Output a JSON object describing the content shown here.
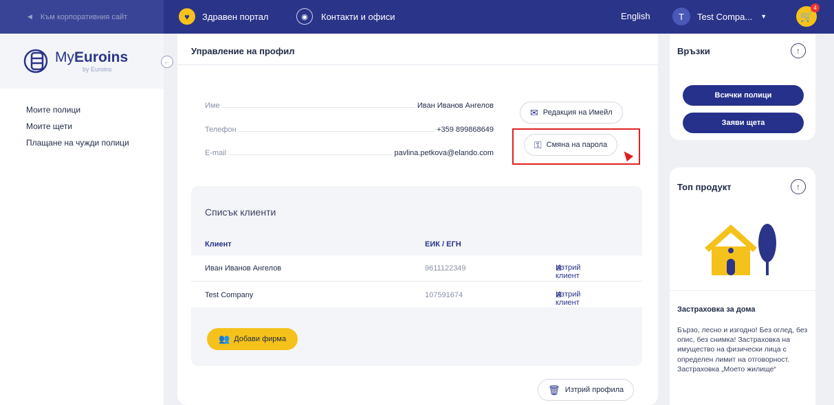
{
  "topbar": {
    "back_link": "Към корпоративния сайт",
    "health_portal": "Здравен портал",
    "contacts": "Контакти и офиси",
    "language": "English",
    "user_initial": "T",
    "user_name": "Test Compa...",
    "cart_count": "4"
  },
  "sidebar": {
    "logo_prefix": "My",
    "logo_bold": "Euroins",
    "logo_sub": "by Euroins",
    "items": [
      {
        "label": "Моите полици"
      },
      {
        "label": "Моите щети"
      },
      {
        "label": "Плащане на чужди полици"
      }
    ]
  },
  "profile": {
    "title": "Управление на профил",
    "name_label": "Име",
    "name_value": "Иван Иванов Ангелов",
    "phone_label": "Телефон",
    "phone_value": "+359 899868649",
    "email_label": "E-mail",
    "email_value": "pavlina.petkova@elando.com",
    "edit_email_btn": "Редакция на Имейл",
    "change_password_btn": "Смяна на парола",
    "delete_profile_btn": "Изтрий профила"
  },
  "clients": {
    "title": "Списък клиенти",
    "col_client": "Клиент",
    "col_eik": "ЕИК / ЕГН",
    "rows": [
      {
        "name": "Иван Иванов Ангелов",
        "eik": "9611122349",
        "action": "Изтрий клиент"
      },
      {
        "name": "Test Company",
        "eik": "107591674",
        "action": "Изтрий клиент"
      }
    ],
    "add_company_btn": "Добави фирма"
  },
  "links_card": {
    "title": "Връзки",
    "all_policies_btn": "Всички полици",
    "claim_btn": "Заяви щета"
  },
  "product_card": {
    "title": "Топ продукт",
    "product_name": "Застраховка за дома",
    "product_desc": "Бързо, лесно и изгодно! Без оглед, без опис, без снимка! Застраховка на имущество на физически лица с определен лимит на отговорност. Застраховка „Моето жилище“"
  },
  "colors": {
    "navy": "#2a3489",
    "accent_yellow": "#f5c21c",
    "highlight_red": "#e02020"
  }
}
